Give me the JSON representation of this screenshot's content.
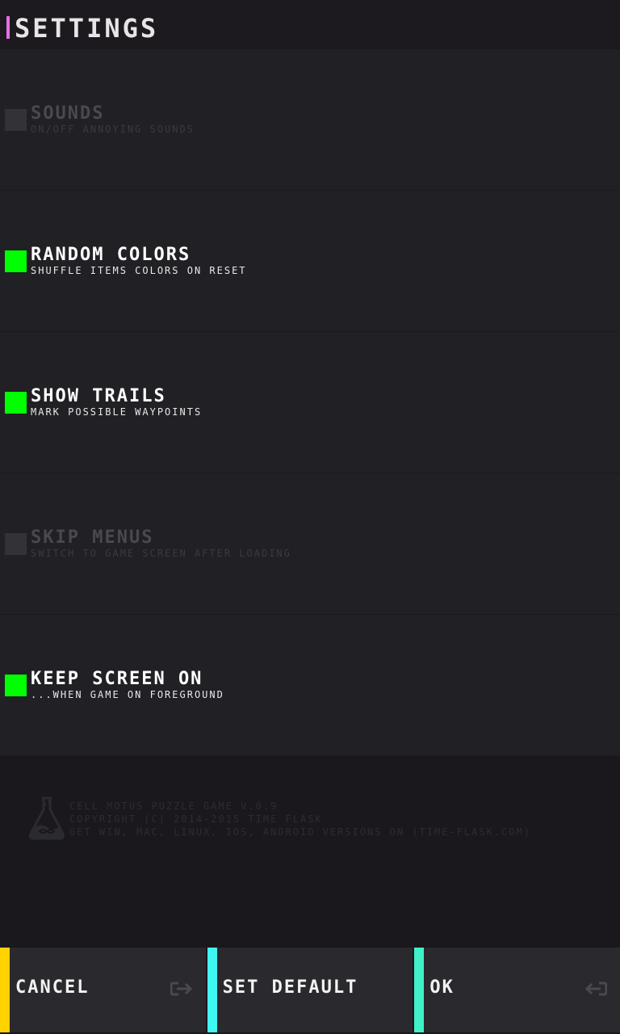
{
  "header": {
    "title": "SETTINGS",
    "accent_color": "#e46fe6"
  },
  "settings": [
    {
      "label": "SOUNDS",
      "description": "ON/OFF ANNOYING SOUNDS",
      "enabled": false
    },
    {
      "label": "RANDOM COLORS",
      "description": "SHUFFLE ITEMS COLORS ON RESET",
      "enabled": true
    },
    {
      "label": "SHOW TRAILS",
      "description": "MARK POSSIBLE WAYPOINTS",
      "enabled": true
    },
    {
      "label": "SKIP MENUS",
      "description": "SWITCH TO GAME SCREEN AFTER LOADING",
      "enabled": false
    },
    {
      "label": "KEEP SCREEN ON",
      "description": "...WHEN GAME ON FOREGROUND",
      "enabled": true
    }
  ],
  "colors": {
    "checkbox_on": "#00ff00",
    "checkbox_off": "#333236",
    "cancel_accent": "#ffd200",
    "default_accent": "#3ff6f0",
    "ok_accent": "#40f0c8"
  },
  "credits": {
    "icon": "flask-icon",
    "line1": "CELL MOTUS PUZZLE GAME V.0.9",
    "line2": "COPYRIGHT (C) 2014-2015 TIME FLASK",
    "line3": "GET WIN, MAC, LINUX, IOS, ANDROID VERSIONS ON (TIME-FLASK.COM)"
  },
  "buttons": {
    "cancel": {
      "label": "CANCEL",
      "icon": "exit-arrow-icon"
    },
    "set_default": {
      "label": "SET DEFAULT"
    },
    "ok": {
      "label": "OK",
      "icon": "return-arrow-icon"
    }
  }
}
